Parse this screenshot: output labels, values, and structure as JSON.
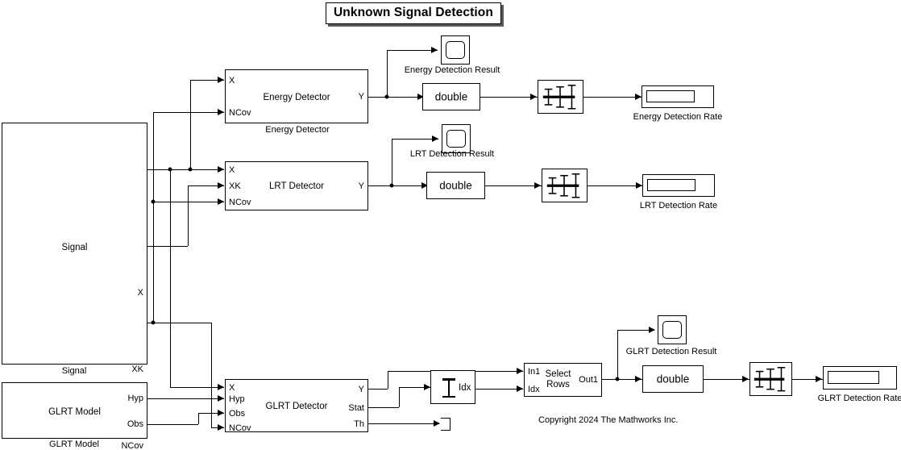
{
  "diagram": {
    "title": "Unknown Signal Detection",
    "copyright": "Copyright 2024 The Mathworks Inc."
  },
  "blocks": {
    "signal": {
      "name": "Signal",
      "label": "Signal",
      "outputs": [
        "X",
        "XK",
        "NCov"
      ]
    },
    "glrt_model": {
      "name": "GLRT Model",
      "label": "GLRT Model",
      "outputs": [
        "Hyp",
        "Obs"
      ]
    },
    "energy_detector": {
      "name": "Energy Detector",
      "label": "Energy Detector",
      "inputs": [
        "X",
        "NCov"
      ],
      "outputs": [
        "Y"
      ]
    },
    "lrt_detector": {
      "name": "LRT Detector",
      "label": "LRT Detector",
      "inputs": [
        "X",
        "XK",
        "NCov"
      ],
      "outputs": [
        "Y"
      ]
    },
    "glrt_detector": {
      "name": "GLRT Detector",
      "label": "GLRT Detector",
      "inputs": [
        "X",
        "Hyp",
        "Obs",
        "NCov"
      ],
      "outputs": [
        "Y",
        "Stat",
        "Th"
      ]
    },
    "select_rows": {
      "name": "Select Rows",
      "label": "Select\nRows",
      "inputs": [
        "In1",
        "Idx"
      ],
      "outputs": [
        "Out1"
      ]
    },
    "idx_block": {
      "name": "Idx",
      "label": "Idx"
    },
    "convert_energy": {
      "label": "double"
    },
    "convert_lrt": {
      "label": "double"
    },
    "convert_glrt": {
      "label": "double"
    },
    "scope_energy": {
      "name": "Energy Detection Result"
    },
    "scope_lrt": {
      "name": "LRT Detection Result"
    },
    "scope_glrt": {
      "name": "GLRT Detection Result"
    },
    "display_energy": {
      "name": "Energy Detection Rate"
    },
    "display_lrt": {
      "name": "LRT Detection Rate"
    },
    "display_glrt": {
      "name": "GLRT Detection Rate"
    },
    "mean_energy": {
      "name": "running-mean"
    },
    "mean_lrt": {
      "name": "running-mean"
    },
    "mean_glrt": {
      "name": "running-mean"
    },
    "terminator": {
      "name": "Terminator"
    }
  },
  "colors": {
    "line": "#000000",
    "background": "#ffffff",
    "shadow": "#5a5a5a"
  }
}
